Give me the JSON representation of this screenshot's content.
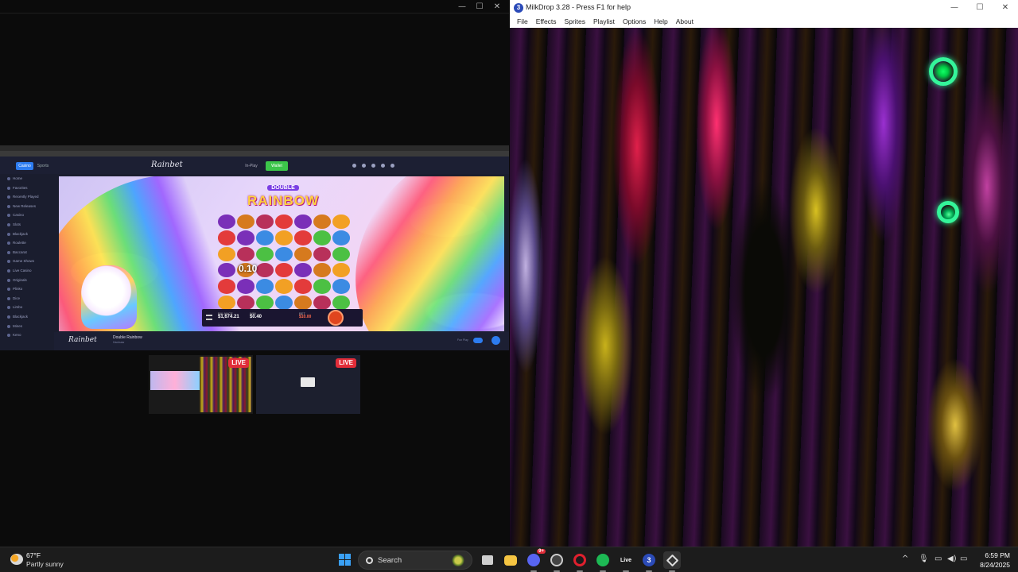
{
  "left_window": {
    "controls": {
      "minimize": "—",
      "maximize": "☐",
      "close": "✕"
    }
  },
  "rainbet": {
    "header": {
      "casino_label": "Casino",
      "sports_label": "Sports",
      "logo": "Rainbet",
      "inplay_label": "In-Play",
      "wallet_label": "Wallet"
    },
    "sidebar": [
      "Home",
      "Favorites",
      "Recently Played",
      "New Releases",
      "Casino",
      "Slots",
      "Blackjack",
      "Roulette",
      "Baccarat",
      "Game Shows",
      "Live Casino",
      "Originals",
      "Plinko",
      "Dice",
      "Limbo",
      "Blackjack",
      "Mines",
      "Keno"
    ],
    "game": {
      "title_top": "DOUBLE",
      "title_main": "RAINBOW",
      "multiplier": "0.10",
      "balance_label": "BALANCE",
      "balance": "$1,674.21",
      "win_label": "WIN",
      "win": "$0.40",
      "bet_label": "BET",
      "bet": "$10.00"
    },
    "footer": {
      "logo": "Rainbet",
      "game_name": "Double Rainbow",
      "provider": "Hacksaw",
      "real_label": "Real",
      "fun_label": "Fun Play"
    }
  },
  "previews": [
    {
      "badge": "LIVE"
    },
    {
      "badge": "LIVE"
    }
  ],
  "milkdrop": {
    "icon_label": "3",
    "title": "MilkDrop 3.28 - Press F1 for help",
    "menu": [
      "File",
      "Effects",
      "Sprites",
      "Playlist",
      "Options",
      "Help",
      "About"
    ],
    "controls": {
      "minimize": "—",
      "maximize": "☐",
      "close": "✕"
    }
  },
  "taskbar": {
    "weather_temp": "67°F",
    "weather_desc": "Partly sunny",
    "search_label": "Search",
    "time": "6:59 PM",
    "date": "8/24/2025",
    "tray_icons": [
      "chevron-up-icon",
      "microphone-icon",
      "network-icon",
      "volume-icon",
      "battery-icon"
    ],
    "apps": [
      {
        "name": "task-view-icon",
        "color": "#cfcfcf"
      },
      {
        "name": "file-explorer-icon",
        "color": "#f5c542"
      },
      {
        "name": "discord-icon",
        "color": "#5865f2"
      },
      {
        "name": "obs-icon",
        "color": "#444444"
      },
      {
        "name": "opera-icon",
        "color": "#e0202e"
      },
      {
        "name": "spotify-icon",
        "color": "#1db954"
      },
      {
        "name": "live-app-icon",
        "color": "#2a2a2a"
      },
      {
        "name": "milkdrop-icon",
        "color": "#2b4bb8"
      },
      {
        "name": "unity-icon",
        "color": "#dddddd"
      }
    ],
    "discord_badge": "9+",
    "live_app_label": "Live",
    "milkdrop_label": "3"
  }
}
